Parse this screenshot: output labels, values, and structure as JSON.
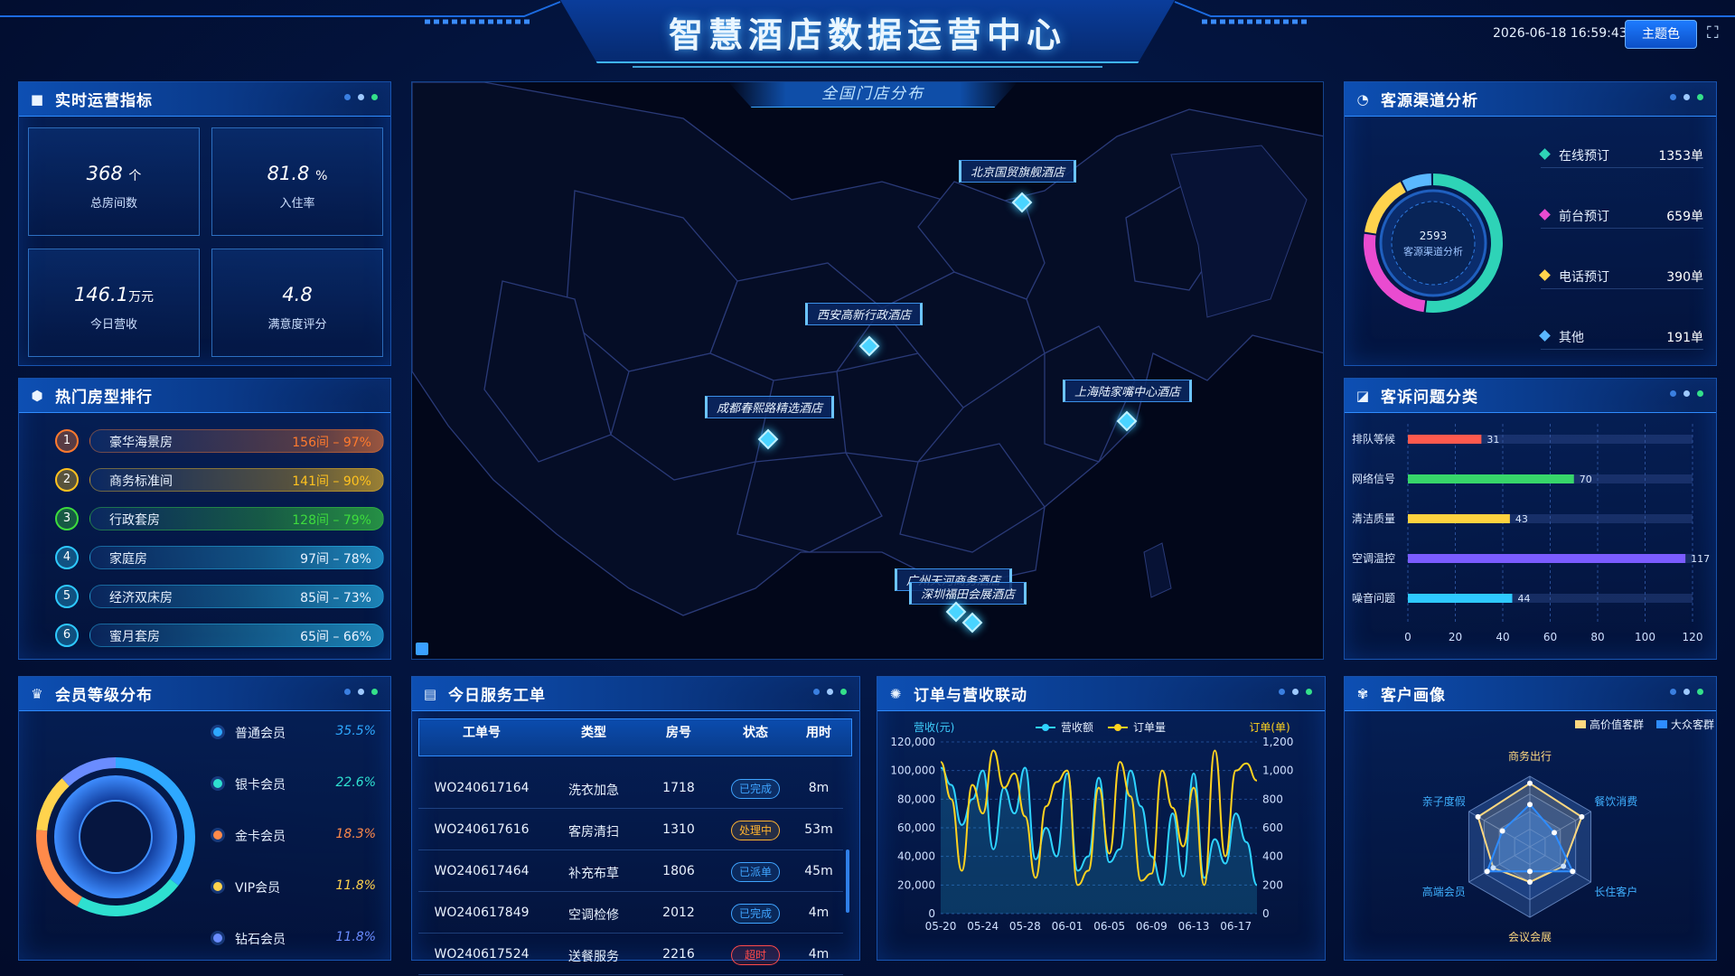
{
  "header": {
    "title": "智慧酒店数据运营中心",
    "datetime": "2026-06-18 16:59:43",
    "theme_button": "主题色",
    "fullscreen_icon": "fullscreen-icon"
  },
  "kpi_panel": {
    "title": "实时运营指标",
    "items": [
      {
        "value": "368",
        "unit": "个",
        "label": "总房间数"
      },
      {
        "value": "81.8",
        "unit": "%",
        "label": "入住率"
      },
      {
        "value": "146.1",
        "unit": "万元",
        "label": "今日营收"
      },
      {
        "value": "4.8",
        "unit": "",
        "label": "满意度评分"
      }
    ]
  },
  "room_rank": {
    "title": "热门房型排行",
    "items": [
      {
        "rank": "1",
        "name": "豪华海景房",
        "value": "156间 – 97%",
        "color": "#ff7a2e",
        "percent": 97
      },
      {
        "rank": "2",
        "name": "商务标准间",
        "value": "141间 – 90%",
        "color": "#ffc21f",
        "percent": 90
      },
      {
        "rank": "3",
        "name": "行政套房",
        "value": "128间 – 79%",
        "color": "#3ddc3d",
        "percent": 79
      },
      {
        "rank": "4",
        "name": "家庭房",
        "value": "97间 – 78%",
        "color": "#2ec9ff",
        "percent": 78
      },
      {
        "rank": "5",
        "name": "经济双床房",
        "value": "85间 – 73%",
        "color": "#2ec9ff",
        "percent": 73
      },
      {
        "rank": "6",
        "name": "蜜月套房",
        "value": "65间 – 66%",
        "color": "#2ec9ff",
        "percent": 66
      }
    ]
  },
  "map": {
    "title": "全国门店分布",
    "hotels": [
      "北京国贸旗舰酒店",
      "西安高新行政酒店",
      "成都春熙路精选酒店",
      "上海陆家嘴中心酒店",
      "广州天河商务酒店",
      "深圳福田会展酒店"
    ]
  },
  "channel": {
    "title": "客源渠道分析",
    "total": "2593",
    "center_label": "客源渠道分析",
    "items": [
      {
        "name": "在线预订",
        "count": "1353单",
        "value": 1353,
        "color": "#2ed3b7"
      },
      {
        "name": "前台预订",
        "count": "659单",
        "value": 659,
        "color": "#e94bd0"
      },
      {
        "name": "电话预订",
        "count": "390单",
        "value": 390,
        "color": "#ffd34d"
      },
      {
        "name": "其他",
        "count": "191单",
        "value": 191,
        "color": "#5ab8ff"
      }
    ]
  },
  "complaints": {
    "title": "客诉问题分类",
    "chart_data": {
      "type": "bar",
      "orientation": "horizontal",
      "categories": [
        "排队等候",
        "网络信号",
        "清洁质量",
        "空调温控",
        "噪音问题"
      ],
      "values": [
        31,
        70,
        43,
        117,
        44
      ],
      "colors": [
        "#ff5a4e",
        "#37d66a",
        "#ffd23f",
        "#7b5cff",
        "#2ec9ff"
      ],
      "xticks": [
        "0",
        "20",
        "40",
        "60",
        "80",
        "100",
        "120"
      ],
      "xlim": [
        0,
        120
      ]
    }
  },
  "members": {
    "title": "会员等级分布",
    "items": [
      {
        "name": "普通会员",
        "percent": "35.5%",
        "value": 35.5,
        "color": "#2ea8ff"
      },
      {
        "name": "银卡会员",
        "percent": "22.6%",
        "value": 22.6,
        "color": "#2ee0d0"
      },
      {
        "name": "金卡会员",
        "percent": "18.3%",
        "value": 18.3,
        "color": "#ff8a4a"
      },
      {
        "name": "VIP会员",
        "percent": "11.8%",
        "value": 11.8,
        "color": "#ffd34d"
      },
      {
        "name": "钻石会员",
        "percent": "11.8%",
        "value": 11.8,
        "color": "#6a8cff"
      }
    ]
  },
  "workorders": {
    "title": "今日服务工单",
    "columns": [
      "工单号",
      "类型",
      "房号",
      "状态",
      "用时"
    ],
    "rows": [
      {
        "id": "WO240617164",
        "type": "洗衣加急",
        "room": "1718",
        "status": "已完成",
        "time": "8m",
        "status_color": "#3fa4ff"
      },
      {
        "id": "WO240617616",
        "type": "客房清扫",
        "room": "1310",
        "status": "处理中",
        "time": "53m",
        "status_color": "#ffb330"
      },
      {
        "id": "WO240617464",
        "type": "补充布草",
        "room": "1806",
        "status": "已派单",
        "time": "45m",
        "status_color": "#3fa4ff"
      },
      {
        "id": "WO240617849",
        "type": "空调检修",
        "room": "2012",
        "status": "已完成",
        "time": "4m",
        "status_color": "#3fa4ff"
      },
      {
        "id": "WO240617524",
        "type": "送餐服务",
        "room": "2216",
        "status": "超时",
        "time": "4m",
        "status_color": "#ff4a4a"
      }
    ]
  },
  "orders": {
    "title": "订单与营收联动",
    "chart_data": {
      "type": "line",
      "x_ticks": [
        "05-20",
        "05-24",
        "05-28",
        "06-01",
        "06-05",
        "06-09",
        "06-13",
        "06-17"
      ],
      "y_left_label": "营收(元)",
      "y_right_label": "订单(单)",
      "y_left_ticks": [
        "0",
        "20,000",
        "40,000",
        "60,000",
        "80,000",
        "100,000",
        "120,000"
      ],
      "y_right_ticks": [
        "0",
        "200",
        "400",
        "600",
        "800",
        "1,000",
        "1,200"
      ],
      "ylim_left": [
        0,
        120000
      ],
      "ylim_right": [
        0,
        1200
      ],
      "series": [
        {
          "name": "营收额",
          "axis": "left",
          "color": "#2ed3ff",
          "values": [
            102000,
            90000,
            62000,
            80000,
            100000,
            45000,
            88000,
            70000,
            102000,
            38000,
            60000,
            40000,
            98000,
            30000,
            40000,
            95000,
            36000,
            45000,
            100000,
            75000,
            40000,
            20000,
            70000,
            26000,
            98000,
            25000,
            52000,
            35000,
            70000,
            50000,
            20000
          ]
        },
        {
          "name": "订单量",
          "axis": "right",
          "color": "#ffd21f",
          "values": [
            1060,
            800,
            300,
            900,
            700,
            1140,
            880,
            980,
            680,
            250,
            750,
            920,
            1000,
            200,
            300,
            880,
            420,
            1060,
            820,
            230,
            280,
            1000,
            740,
            470,
            880,
            200,
            1140,
            400,
            1000,
            1050,
            930
          ]
        }
      ]
    }
  },
  "portrait": {
    "title": "客户画像",
    "chart_data": {
      "type": "radar",
      "axes": [
        "商务出行",
        "餐饮消费",
        "长住客户",
        "会议会展",
        "高端会员",
        "亲子度假"
      ],
      "series": [
        {
          "name": "高价值客群",
          "color": "#ffd880",
          "values": [
            90,
            85,
            55,
            50,
            60,
            85
          ]
        },
        {
          "name": "大众客群",
          "color": "#2e8cff",
          "values": [
            60,
            40,
            70,
            35,
            70,
            45
          ]
        }
      ],
      "max": 100
    }
  }
}
